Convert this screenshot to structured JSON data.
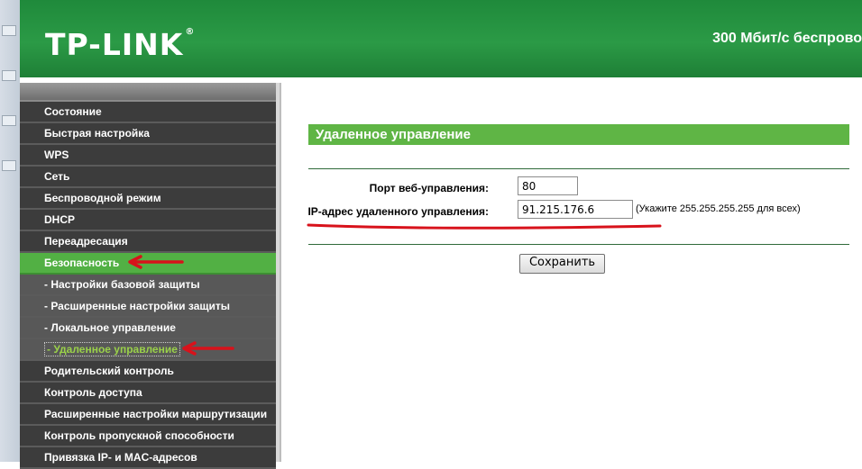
{
  "header": {
    "logo": "TP-LINK",
    "logo_mark": "®",
    "tagline": "300 Мбит/с беспрово",
    "colors": {
      "header_green": "#2b9a46",
      "accent_green": "#5fb545",
      "annotation_red": "#d8121b"
    }
  },
  "sidebar": {
    "items": [
      {
        "label": "Состояние"
      },
      {
        "label": "Быстрая настройка"
      },
      {
        "label": "WPS"
      },
      {
        "label": "Сеть"
      },
      {
        "label": "Беспроводной режим"
      },
      {
        "label": "DHCP"
      },
      {
        "label": "Переадресация"
      },
      {
        "label": "Безопасность"
      },
      {
        "label": "- Настройки базовой защиты"
      },
      {
        "label": "- Расширенные настройки защиты"
      },
      {
        "label": "- Локальное управление"
      },
      {
        "label": "- Удаленное управление"
      },
      {
        "label": "Родительский контроль"
      },
      {
        "label": "Контроль доступа"
      },
      {
        "label": "Расширенные настройки маршрутизации"
      },
      {
        "label": "Контроль пропускной способности"
      },
      {
        "label": "Привязка IP- и MAC-адресов"
      }
    ]
  },
  "main": {
    "section_title": "Удаленное управление",
    "port_label": "Порт веб-управления:",
    "port_value": "80",
    "ip_label": "IP-адрес удаленного управления:",
    "ip_value": "91.215.176.6",
    "ip_hint": "(Укажите 255.255.255.255 для всех)",
    "save_label": "Сохранить"
  }
}
